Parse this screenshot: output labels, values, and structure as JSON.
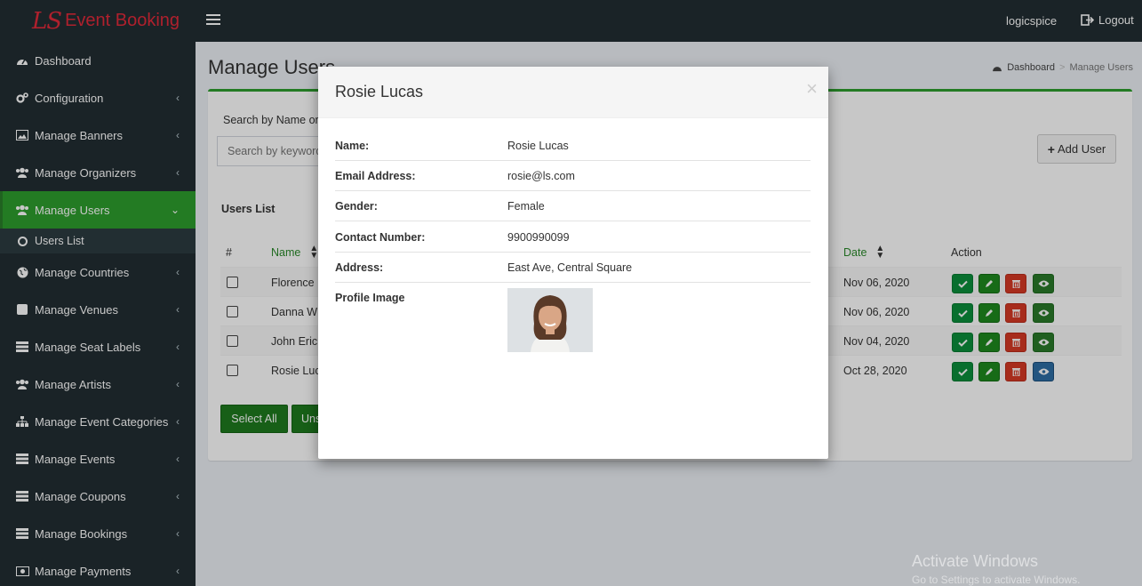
{
  "header": {
    "brand_logo": "LS",
    "brand_text": "Event Booking",
    "username": "logicspice",
    "logout": "Logout"
  },
  "sidebar": {
    "items": [
      {
        "label": "Dashboard",
        "icon": "dashboard-icon"
      },
      {
        "label": "Configuration",
        "icon": "cogs-icon"
      },
      {
        "label": "Manage Banners",
        "icon": "image-icon"
      },
      {
        "label": "Manage Organizers",
        "icon": "users-icon"
      },
      {
        "label": "Manage Users",
        "icon": "users-icon"
      },
      {
        "label": "Manage Countries",
        "icon": "globe-icon"
      },
      {
        "label": "Manage Venues",
        "icon": "square-icon"
      },
      {
        "label": "Manage Seat Labels",
        "icon": "list-icon"
      },
      {
        "label": "Manage Artists",
        "icon": "users-icon"
      },
      {
        "label": "Manage Event Categories",
        "icon": "sitemap-icon"
      },
      {
        "label": "Manage Events",
        "icon": "list-icon"
      },
      {
        "label": "Manage Coupons",
        "icon": "list-icon"
      },
      {
        "label": "Manage Bookings",
        "icon": "list-icon"
      },
      {
        "label": "Manage Payments",
        "icon": "money-icon"
      }
    ],
    "subitem": "Users List"
  },
  "page": {
    "title": "Manage Users",
    "breadcrumb_home": "Dashboard",
    "breadcrumb_current": "Manage Users",
    "search_label": "Search by Name or",
    "search_placeholder": "Search by keyword",
    "add_user": "Add User",
    "list_title": "Users List",
    "select_all": "Select All",
    "unselect_all": "Uns"
  },
  "table": {
    "headers": {
      "num": "#",
      "name": "Name",
      "date": "Date",
      "action": "Action"
    },
    "rows": [
      {
        "name": "Florence",
        "date": "Nov 06, 2020"
      },
      {
        "name": "Danna Wh",
        "date": "Nov 06, 2020"
      },
      {
        "name": "John Eric",
        "date": "Nov 04, 2020"
      },
      {
        "name": "Rosie Luc",
        "date": "Oct 28, 2020"
      }
    ]
  },
  "modal": {
    "title": "Rosie Lucas",
    "close": "×",
    "fields": [
      {
        "label": "Name:",
        "value": "Rosie Lucas"
      },
      {
        "label": "Email Address:",
        "value": "rosie@ls.com"
      },
      {
        "label": "Gender:",
        "value": "Female"
      },
      {
        "label": "Contact Number:",
        "value": "9900990099"
      },
      {
        "label": "Address:",
        "value": "East Ave, Central Square"
      },
      {
        "label": "Profile Image",
        "value": ""
      }
    ]
  },
  "watermark": {
    "line1": "Activate Windows",
    "line2": "Go to Settings to activate Windows."
  },
  "colors": {
    "sidebar_bg": "#222d32",
    "active_green": "#2e9e2e",
    "brand_red": "#e02a3a",
    "danger": "#d73925",
    "primary": "#2e6da4"
  }
}
